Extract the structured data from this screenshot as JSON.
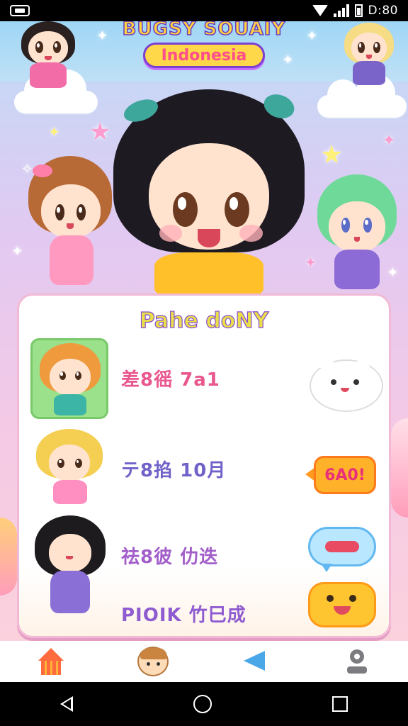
{
  "status_bar": {
    "time": "D:80"
  },
  "game": {
    "logo_title": "BUGSY SOUAIY",
    "logo_subtitle": "Indonesia"
  },
  "panel": {
    "title": "Pahe doNY",
    "rows": [
      {
        "label": "差8徭 7a1",
        "label_color": "#e8578e",
        "icon": "white-cat-icon"
      },
      {
        "label": "テ8掐 10月",
        "label_color": "#6f62c8",
        "icon": "speech-badge-icon",
        "badge_text": "6A0!"
      },
      {
        "label": "祛8彼 仂迭",
        "label_color": "#a25fc9",
        "icon": "blue-speech-bubble-icon"
      },
      {
        "label": "PIOIK 竹巳成",
        "label_color": "#8e5bd0",
        "icon": "yellow-cat-face-icon"
      }
    ]
  },
  "bottom_nav": [
    {
      "name": "home-house-icon"
    },
    {
      "name": "hamster-friend-icon"
    },
    {
      "name": "megaphone-icon"
    },
    {
      "name": "profile-camera-icon"
    }
  ],
  "colors": {
    "panel_border": "#f1b9d6",
    "title_fill": "#e8e04a",
    "title_stroke": "#8a4bd0",
    "badge_orange": "#ffb12a"
  }
}
